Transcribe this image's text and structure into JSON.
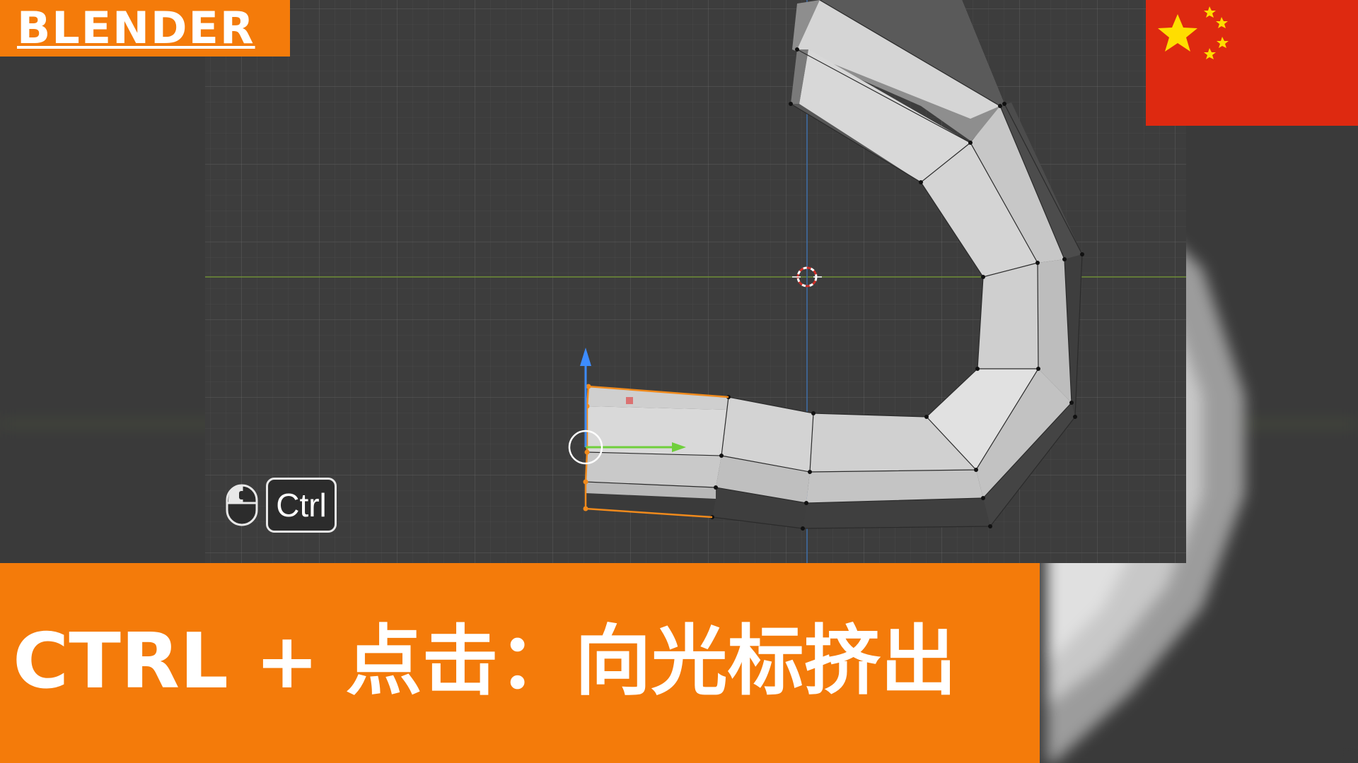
{
  "badge": {
    "label": "BLENDER"
  },
  "shortcut_hint": {
    "key_label": "Ctrl",
    "mouse_icon": "left-mouse-button-icon"
  },
  "caption": {
    "text": "CTRL + 点击：向光标挤出"
  },
  "flag": {
    "icon": "china-flag-icon",
    "colors": {
      "field": "#de2910",
      "stars": "#ffde00"
    }
  },
  "colors": {
    "accent": "#f47b0a",
    "viewport_bg": "#3d3d3d",
    "selection": "#f08a1c",
    "gizmo_z": "#3d8cff",
    "gizmo_y": "#6fcf3c",
    "axis_x": "#7a9a3c",
    "axis_y": "#4a78b0"
  }
}
